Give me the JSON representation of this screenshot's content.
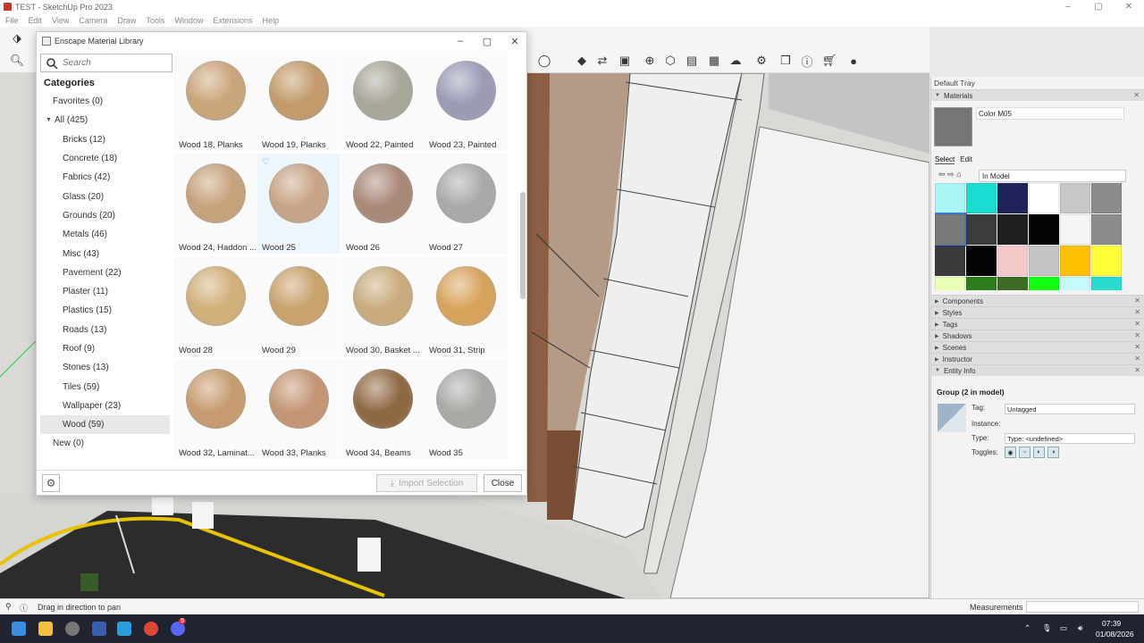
{
  "window": {
    "title": "TEST - SketchUp Pro 2023"
  },
  "menu": [
    "File",
    "Edit",
    "View",
    "Camera",
    "Draw",
    "Tools",
    "Window",
    "Extensions",
    "Help"
  ],
  "dialog": {
    "title": "Enscape Material Library",
    "search_placeholder": "Search",
    "categories_heading": "Categories",
    "categories": [
      {
        "label": "Favorites (0)",
        "level": 0
      },
      {
        "label": "All (425)",
        "level": 0,
        "expanded": true
      },
      {
        "label": "Bricks (12)",
        "level": 1
      },
      {
        "label": "Concrete (18)",
        "level": 1
      },
      {
        "label": "Fabrics (42)",
        "level": 1
      },
      {
        "label": "Glass (20)",
        "level": 1
      },
      {
        "label": "Grounds (20)",
        "level": 1
      },
      {
        "label": "Metals (46)",
        "level": 1
      },
      {
        "label": "Misc (43)",
        "level": 1
      },
      {
        "label": "Pavement (22)",
        "level": 1
      },
      {
        "label": "Plaster (11)",
        "level": 1
      },
      {
        "label": "Plastics (15)",
        "level": 1
      },
      {
        "label": "Roads (13)",
        "level": 1
      },
      {
        "label": "Roof (9)",
        "level": 1
      },
      {
        "label": "Stones (13)",
        "level": 1
      },
      {
        "label": "Tiles (59)",
        "level": 1
      },
      {
        "label": "Wallpaper (23)",
        "level": 1
      },
      {
        "label": "Wood (59)",
        "level": 1,
        "selected": true
      },
      {
        "label": "New (0)",
        "level": 0
      }
    ],
    "materials": [
      {
        "name": "Wood 18, Planks",
        "color": "#c9a57a",
        "pattern": "h"
      },
      {
        "name": "Wood 19, Planks",
        "color": "#c39a6b",
        "pattern": "v"
      },
      {
        "name": "Wood 22, Painted",
        "color": "#a9a79b",
        "pattern": "none"
      },
      {
        "name": "Wood 23, Painted",
        "color": "#9a9cb4",
        "pattern": "none"
      },
      {
        "name": "Wood 24, Haddon ...",
        "color": "#c6a27c",
        "pattern": "h"
      },
      {
        "name": "Wood 25",
        "color": "#c7a487",
        "pattern": "none",
        "hover": true
      },
      {
        "name": "Wood 26",
        "color": "#a88877",
        "pattern": "none"
      },
      {
        "name": "Wood 27",
        "color": "#a9a9a9",
        "pattern": "none"
      },
      {
        "name": "Wood 28",
        "color": "#d1b07a",
        "pattern": "h"
      },
      {
        "name": "Wood 29",
        "color": "#c9a26c",
        "pattern": "none"
      },
      {
        "name": "Wood 30, Basket ...",
        "color": "#c8ac7e",
        "pattern": "none"
      },
      {
        "name": "Wood 31, Strip",
        "color": "#d7a35c",
        "pattern": "none"
      },
      {
        "name": "Wood 32, Laminat...",
        "color": "#c69b6f",
        "pattern": "h"
      },
      {
        "name": "Wood 33, Planks",
        "color": "#c49574",
        "pattern": "none"
      },
      {
        "name": "Wood 34, Beams",
        "color": "#8e6843",
        "pattern": "v"
      },
      {
        "name": "Wood 35",
        "color": "#a9a9a6",
        "pattern": "none"
      }
    ],
    "import_label": "Import Selection",
    "close_label": "Close"
  },
  "tray": {
    "title": "Default Tray",
    "materials_header": "Materials",
    "material_name": "Color M05",
    "tabs": [
      "Select",
      "Edit"
    ],
    "library": "In Model",
    "swatches": [
      "#a7f5f5",
      "#19dcd2",
      "#23235c",
      "#ffffff",
      "#c7c7c7",
      "#8c8c8c",
      "#7a7a7a",
      "#3c3c3c",
      "#202020",
      "#050505",
      "#f5f5f5",
      "#8c8c8c",
      "#3a3a3a",
      "#050505",
      "#f5c8cc",
      "#c4c4c4",
      "#ffc000",
      "#ffff3a",
      "#e8ffb4",
      "#2e7d1c",
      "#3f6b25",
      "#12ff12",
      "#c4fbff",
      "#2adccf"
    ],
    "panels": [
      "Components",
      "Styles",
      "Tags",
      "Shadows",
      "Scenes",
      "Instructor",
      "Entity Info"
    ],
    "entity": {
      "title": "Group (2 in model)",
      "tag_label": "Tag:",
      "tag_value": "Untagged",
      "instance_label": "Instance:",
      "type_label": "Type:",
      "type_value": "Type: <undefined>",
      "toggles_label": "Toggles:"
    }
  },
  "status": {
    "hint": "Drag in direction to pan",
    "measurements_label": "Measurements"
  },
  "taskbar": {
    "time": "07:39",
    "date": "01/08/2026",
    "badge": "9"
  }
}
